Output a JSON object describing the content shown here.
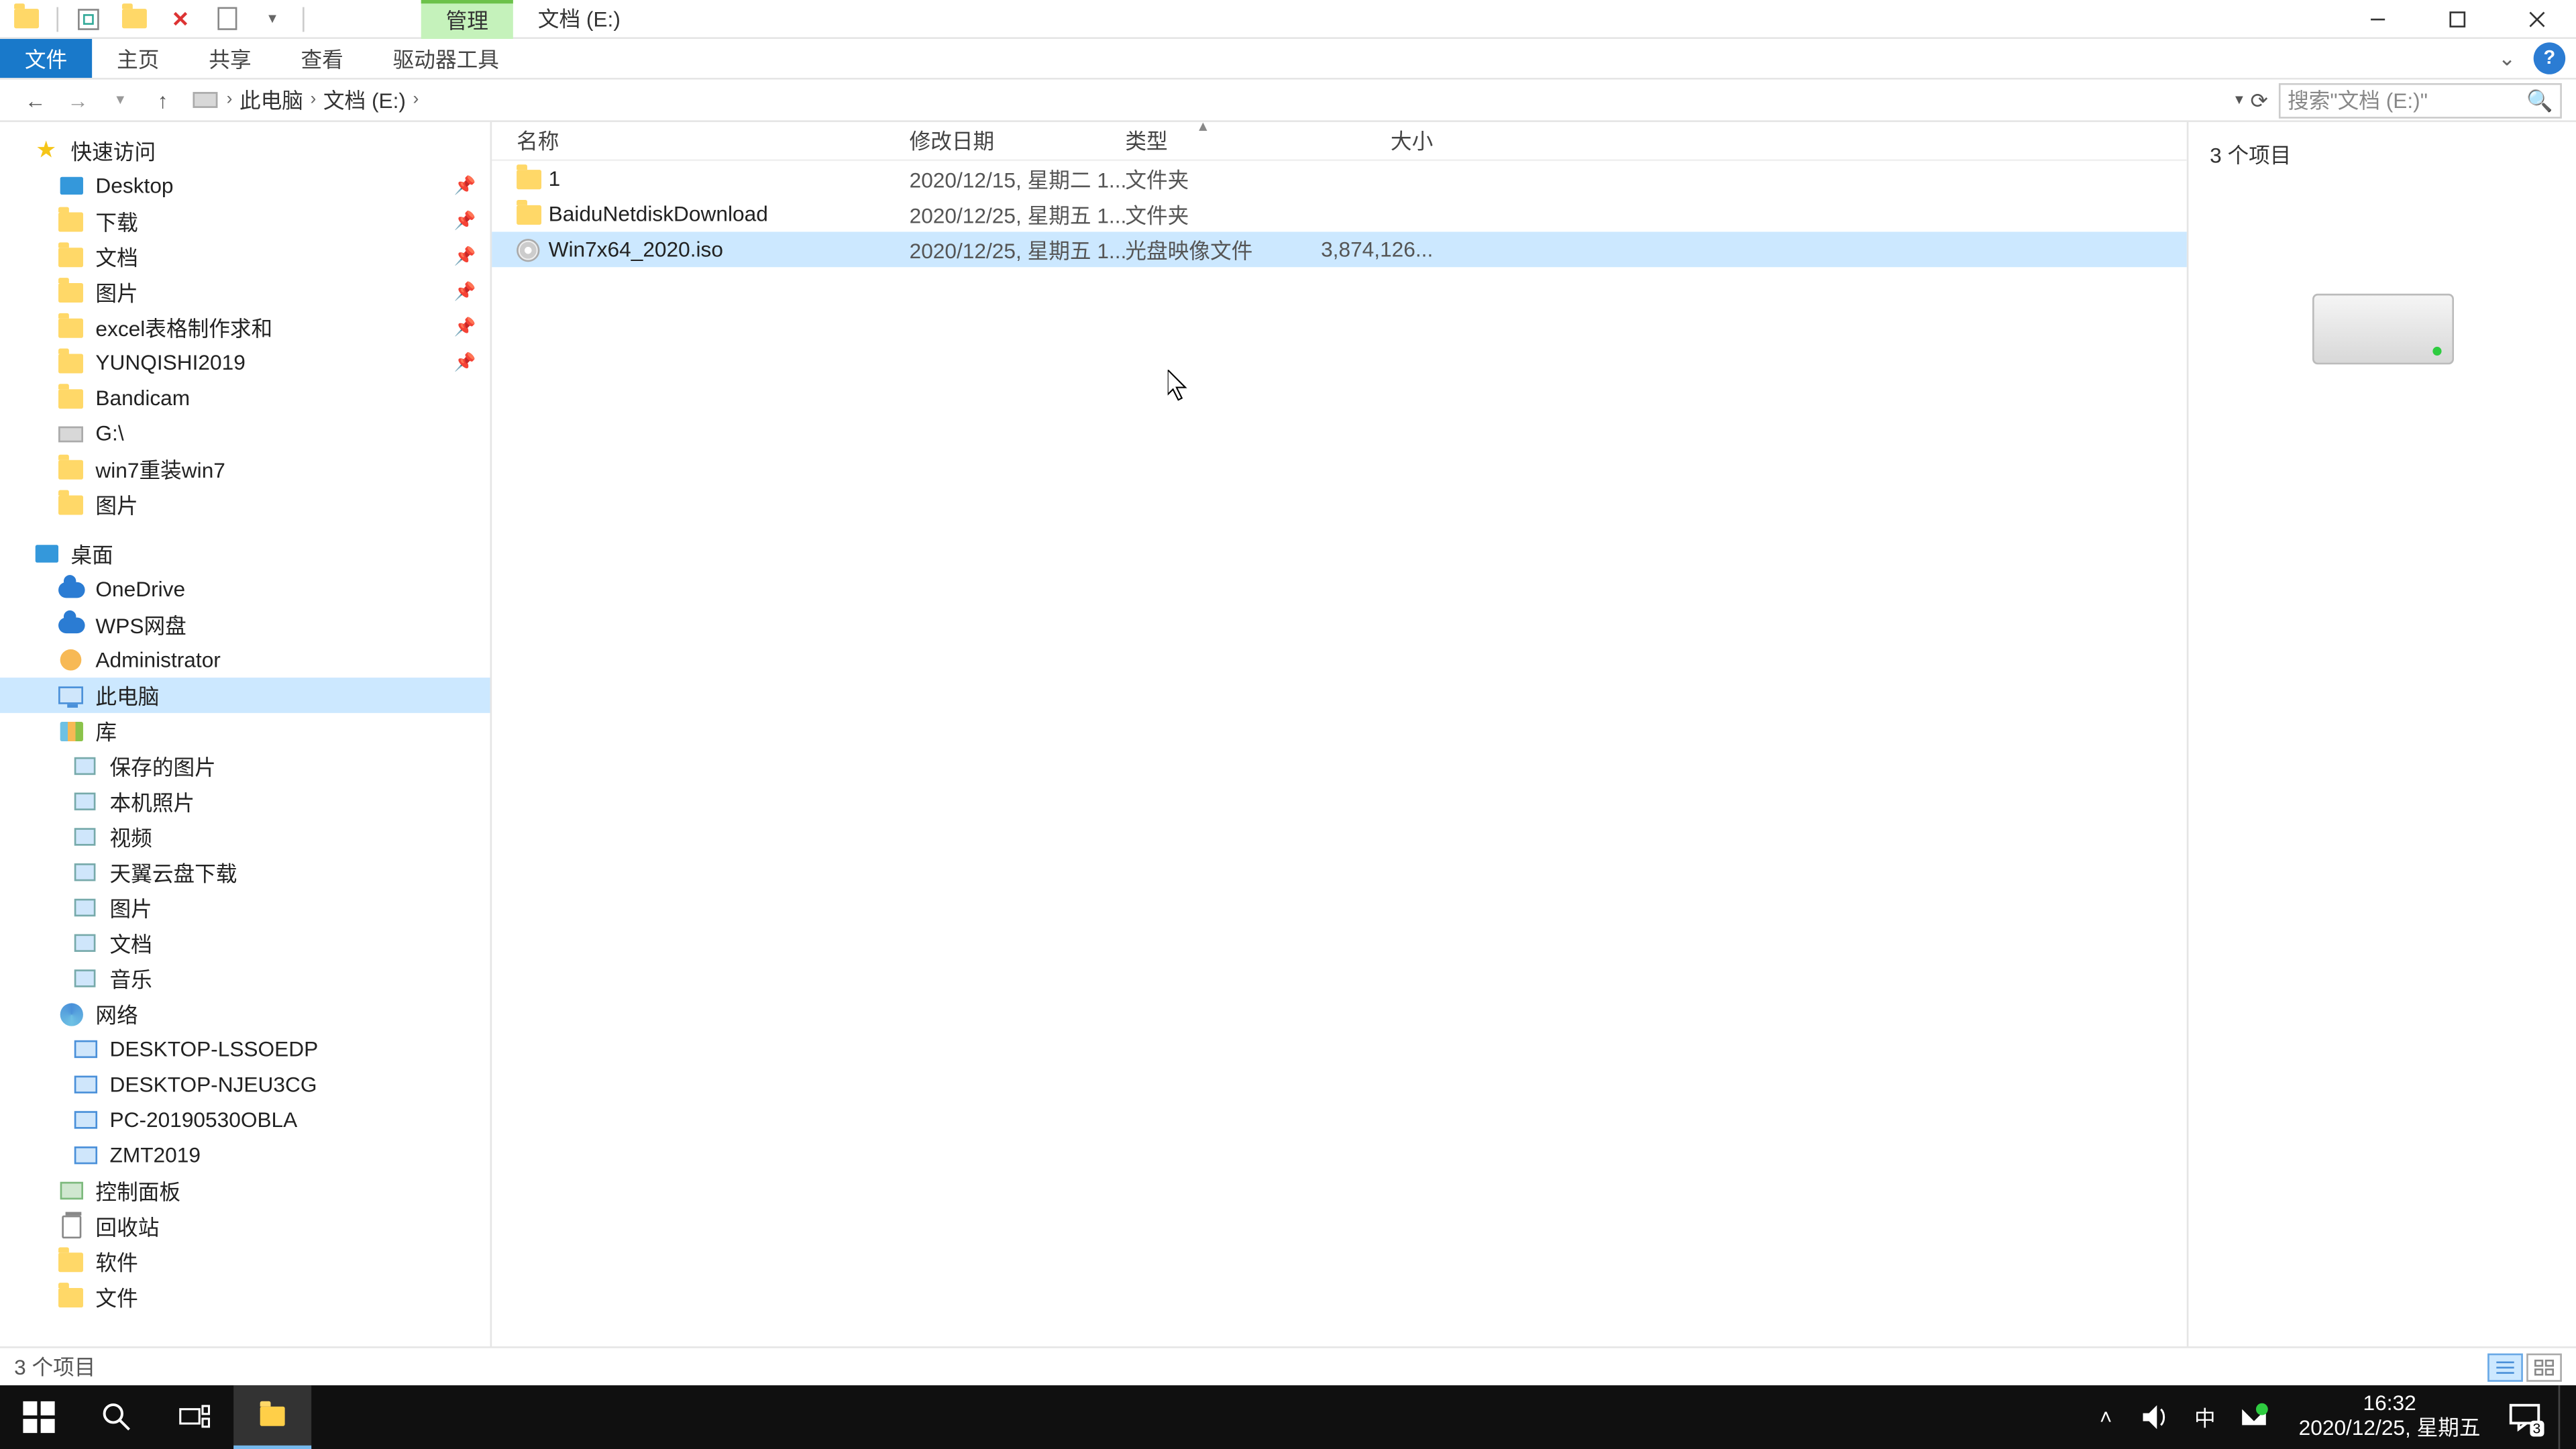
{
  "title": {
    "context_tab": "管理",
    "location": "文档 (E:)"
  },
  "ribbon": {
    "file": "文件",
    "tabs": [
      "主页",
      "共享",
      "查看",
      "驱动器工具"
    ]
  },
  "address": {
    "segments": [
      "此电脑",
      "文档 (E:)"
    ]
  },
  "search": {
    "placeholder": "搜索\"文档 (E:)\""
  },
  "sidebar": {
    "quick_access": "快速访问",
    "qa_items": [
      {
        "label": "Desktop",
        "pin": true,
        "icon": "desktop"
      },
      {
        "label": "下载",
        "pin": true,
        "icon": "folder"
      },
      {
        "label": "文档",
        "pin": true,
        "icon": "folder"
      },
      {
        "label": "图片",
        "pin": true,
        "icon": "folder"
      },
      {
        "label": "excel表格制作求和",
        "pin": true,
        "icon": "folder"
      },
      {
        "label": "YUNQISHI2019",
        "pin": true,
        "icon": "folder"
      },
      {
        "label": "Bandicam",
        "pin": false,
        "icon": "folder"
      },
      {
        "label": "G:\\",
        "pin": false,
        "icon": "drive"
      },
      {
        "label": "win7重装win7",
        "pin": false,
        "icon": "folder"
      },
      {
        "label": "图片",
        "pin": false,
        "icon": "folder"
      }
    ],
    "desktop": "桌面",
    "desktop_items": [
      {
        "label": "OneDrive",
        "icon": "cloud"
      },
      {
        "label": "WPS网盘",
        "icon": "cloud"
      },
      {
        "label": "Administrator",
        "icon": "user"
      },
      {
        "label": "此电脑",
        "icon": "pc",
        "selected": true
      },
      {
        "label": "库",
        "icon": "lib"
      }
    ],
    "lib_items": [
      {
        "label": "保存的图片"
      },
      {
        "label": "本机照片"
      },
      {
        "label": "视频"
      },
      {
        "label": "天翼云盘下载"
      },
      {
        "label": "图片"
      },
      {
        "label": "文档"
      },
      {
        "label": "音乐"
      }
    ],
    "network": "网络",
    "net_items": [
      {
        "label": "DESKTOP-LSSOEDP"
      },
      {
        "label": "DESKTOP-NJEU3CG"
      },
      {
        "label": "PC-20190530OBLA"
      },
      {
        "label": "ZMT2019"
      }
    ],
    "others": [
      {
        "label": "控制面板",
        "icon": "cp"
      },
      {
        "label": "回收站",
        "icon": "recycle"
      },
      {
        "label": "软件",
        "icon": "folder"
      },
      {
        "label": "文件",
        "icon": "folder"
      }
    ]
  },
  "columns": {
    "name": "名称",
    "date": "修改日期",
    "type": "类型",
    "size": "大小"
  },
  "files": [
    {
      "icon": "folder",
      "name": "1",
      "date": "2020/12/15, 星期二 1...",
      "type": "文件夹",
      "size": ""
    },
    {
      "icon": "folder",
      "name": "BaiduNetdiskDownload",
      "date": "2020/12/25, 星期五 1...",
      "type": "文件夹",
      "size": ""
    },
    {
      "icon": "disc",
      "name": "Win7x64_2020.iso",
      "date": "2020/12/25, 星期五 1...",
      "type": "光盘映像文件",
      "size": "3,874,126...",
      "selected": true
    }
  ],
  "preview": {
    "title": "3 个项目"
  },
  "status": {
    "text": "3 个项目"
  },
  "taskbar": {
    "time": "16:32",
    "date": "2020/12/25, 星期五",
    "ime": "中",
    "action_badge": "3"
  }
}
